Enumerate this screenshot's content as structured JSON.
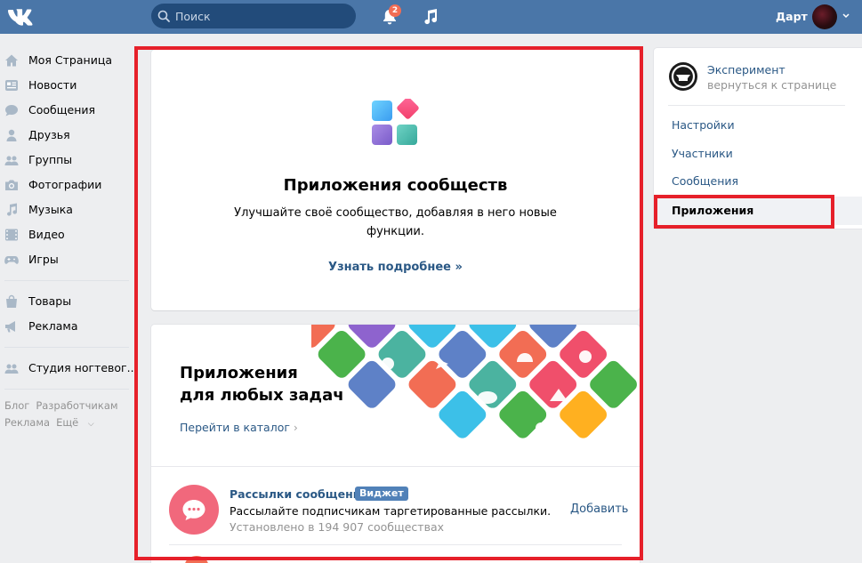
{
  "header": {
    "search_placeholder": "Поиск",
    "notifications_count": "2",
    "user_name": "Дарт"
  },
  "leftnav": {
    "items": [
      {
        "label": "Моя Страница",
        "icon": "home-icon"
      },
      {
        "label": "Новости",
        "icon": "news-icon"
      },
      {
        "label": "Сообщения",
        "icon": "messages-icon"
      },
      {
        "label": "Друзья",
        "icon": "friends-icon"
      },
      {
        "label": "Группы",
        "icon": "groups-icon"
      },
      {
        "label": "Фотографии",
        "icon": "camera-icon"
      },
      {
        "label": "Музыка",
        "icon": "music-icon"
      },
      {
        "label": "Видео",
        "icon": "video-icon"
      },
      {
        "label": "Игры",
        "icon": "gamepad-icon"
      }
    ],
    "items2": [
      {
        "label": "Товары",
        "icon": "bag-icon"
      },
      {
        "label": "Реклама",
        "icon": "megaphone-icon"
      }
    ],
    "items3": [
      {
        "label": "Студия ногтевог..",
        "icon": "group-icon"
      }
    ],
    "footer": [
      "Блог",
      "Разработчикам",
      "Реклама",
      "Ещё"
    ]
  },
  "intro_card": {
    "title": "Приложения сообществ",
    "description": "Улучшайте своё сообщество, добавляя в него новые функции.",
    "link": "Узнать подробнее »"
  },
  "promo": {
    "title_line1": "Приложения",
    "title_line2": "для любых задач",
    "catalog_link": "Перейти в каталог"
  },
  "app": {
    "name": "Рассылки сообщений",
    "badge": "Виджет",
    "description": "Рассылайте подписчикам таргетированные рассылки.",
    "installs": "Установлено в 194 907 сообществах",
    "add_label": "Добавить"
  },
  "rightpanel": {
    "group_name": "Эксперимент",
    "back_label": "вернуться к странице",
    "items": [
      "Настройки",
      "Участники",
      "Сообщения",
      "Приложения"
    ],
    "active_index": 3
  },
  "colors": {
    "brand": "#4a76a8",
    "link": "#2a5885",
    "highlight": "#e6202a"
  }
}
